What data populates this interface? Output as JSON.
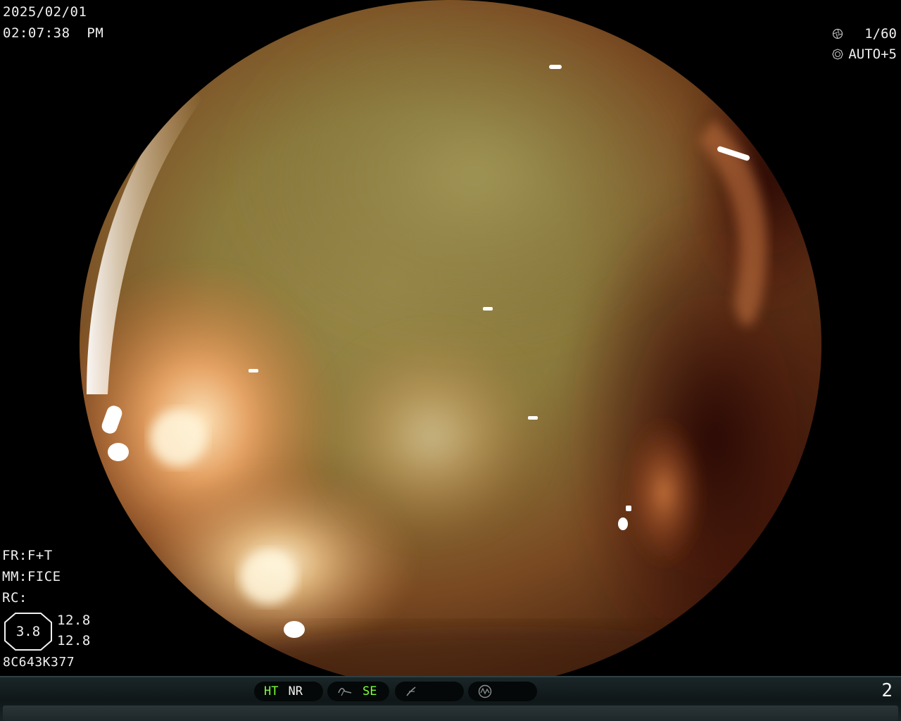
{
  "osd": {
    "date": "2025/02/01",
    "time": "02:07:38  PM",
    "shutter": "1/60",
    "shutter_icon": "aperture-icon",
    "iris": "AUTO+5",
    "iris_icon": "iris-icon",
    "fr": "FR:F+T",
    "mm": "MM:FICE",
    "rc": "RC:",
    "octagon_value": "3.8",
    "value_1": "12.8",
    "value_2": "12.8",
    "serial": "8C643K377"
  },
  "statusbar": {
    "ht": "HT",
    "nr": "NR",
    "se": "SE",
    "page": "2",
    "colors": {
      "active": "#7cff3a",
      "inactive": "#f0f0f0",
      "icon": "#8a9092"
    }
  }
}
